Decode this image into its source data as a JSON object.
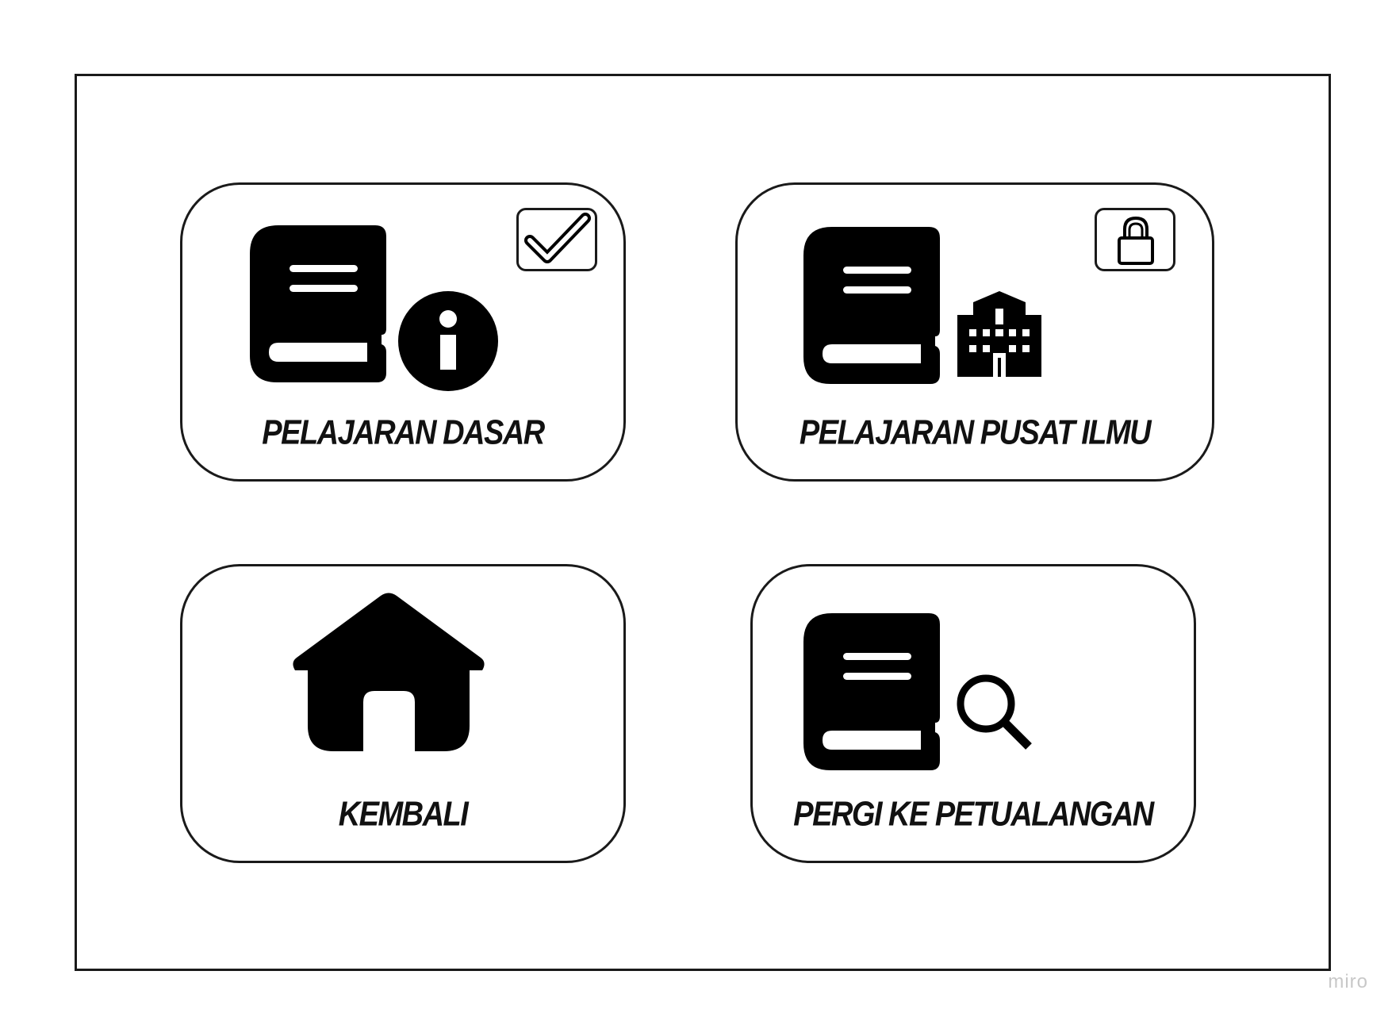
{
  "cards": [
    {
      "label": "Pelajaran Dasar",
      "status": "completed",
      "icons": [
        "book-icon",
        "info-icon",
        "checkbox-checked-icon"
      ]
    },
    {
      "label": "Pelajaran Pusat Ilmu",
      "status": "locked",
      "icons": [
        "book-icon",
        "building-icon",
        "lock-icon"
      ]
    },
    {
      "label": "Kembali",
      "icons": [
        "home-icon"
      ]
    },
    {
      "label": "Pergi ke Petualangan",
      "icons": [
        "book-icon",
        "search-icon"
      ]
    }
  ],
  "watermark": "miro",
  "colors": {
    "ink": "#000000",
    "border": "#1a1a1a",
    "background": "#ffffff",
    "watermark": "#c8c8c8"
  }
}
